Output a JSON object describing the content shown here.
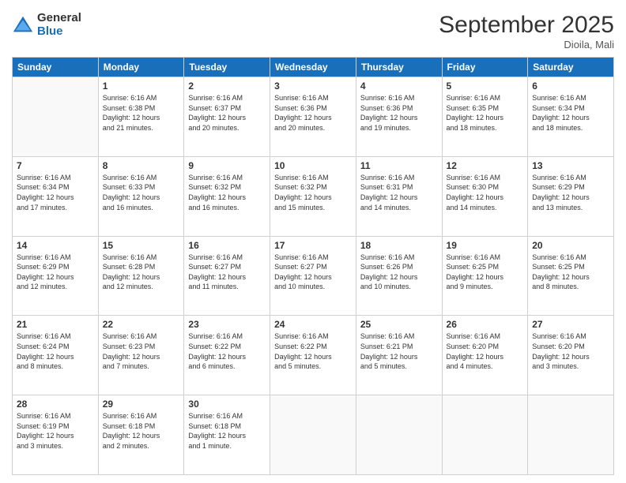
{
  "header": {
    "logo_general": "General",
    "logo_blue": "Blue",
    "month_title": "September 2025",
    "subtitle": "Dioila, Mali"
  },
  "weekdays": [
    "Sunday",
    "Monday",
    "Tuesday",
    "Wednesday",
    "Thursday",
    "Friday",
    "Saturday"
  ],
  "weeks": [
    [
      {
        "day": "",
        "info": ""
      },
      {
        "day": "1",
        "info": "Sunrise: 6:16 AM\nSunset: 6:38 PM\nDaylight: 12 hours\nand 21 minutes."
      },
      {
        "day": "2",
        "info": "Sunrise: 6:16 AM\nSunset: 6:37 PM\nDaylight: 12 hours\nand 20 minutes."
      },
      {
        "day": "3",
        "info": "Sunrise: 6:16 AM\nSunset: 6:36 PM\nDaylight: 12 hours\nand 20 minutes."
      },
      {
        "day": "4",
        "info": "Sunrise: 6:16 AM\nSunset: 6:36 PM\nDaylight: 12 hours\nand 19 minutes."
      },
      {
        "day": "5",
        "info": "Sunrise: 6:16 AM\nSunset: 6:35 PM\nDaylight: 12 hours\nand 18 minutes."
      },
      {
        "day": "6",
        "info": "Sunrise: 6:16 AM\nSunset: 6:34 PM\nDaylight: 12 hours\nand 18 minutes."
      }
    ],
    [
      {
        "day": "7",
        "info": "Sunrise: 6:16 AM\nSunset: 6:34 PM\nDaylight: 12 hours\nand 17 minutes."
      },
      {
        "day": "8",
        "info": "Sunrise: 6:16 AM\nSunset: 6:33 PM\nDaylight: 12 hours\nand 16 minutes."
      },
      {
        "day": "9",
        "info": "Sunrise: 6:16 AM\nSunset: 6:32 PM\nDaylight: 12 hours\nand 16 minutes."
      },
      {
        "day": "10",
        "info": "Sunrise: 6:16 AM\nSunset: 6:32 PM\nDaylight: 12 hours\nand 15 minutes."
      },
      {
        "day": "11",
        "info": "Sunrise: 6:16 AM\nSunset: 6:31 PM\nDaylight: 12 hours\nand 14 minutes."
      },
      {
        "day": "12",
        "info": "Sunrise: 6:16 AM\nSunset: 6:30 PM\nDaylight: 12 hours\nand 14 minutes."
      },
      {
        "day": "13",
        "info": "Sunrise: 6:16 AM\nSunset: 6:29 PM\nDaylight: 12 hours\nand 13 minutes."
      }
    ],
    [
      {
        "day": "14",
        "info": "Sunrise: 6:16 AM\nSunset: 6:29 PM\nDaylight: 12 hours\nand 12 minutes."
      },
      {
        "day": "15",
        "info": "Sunrise: 6:16 AM\nSunset: 6:28 PM\nDaylight: 12 hours\nand 12 minutes."
      },
      {
        "day": "16",
        "info": "Sunrise: 6:16 AM\nSunset: 6:27 PM\nDaylight: 12 hours\nand 11 minutes."
      },
      {
        "day": "17",
        "info": "Sunrise: 6:16 AM\nSunset: 6:27 PM\nDaylight: 12 hours\nand 10 minutes."
      },
      {
        "day": "18",
        "info": "Sunrise: 6:16 AM\nSunset: 6:26 PM\nDaylight: 12 hours\nand 10 minutes."
      },
      {
        "day": "19",
        "info": "Sunrise: 6:16 AM\nSunset: 6:25 PM\nDaylight: 12 hours\nand 9 minutes."
      },
      {
        "day": "20",
        "info": "Sunrise: 6:16 AM\nSunset: 6:25 PM\nDaylight: 12 hours\nand 8 minutes."
      }
    ],
    [
      {
        "day": "21",
        "info": "Sunrise: 6:16 AM\nSunset: 6:24 PM\nDaylight: 12 hours\nand 8 minutes."
      },
      {
        "day": "22",
        "info": "Sunrise: 6:16 AM\nSunset: 6:23 PM\nDaylight: 12 hours\nand 7 minutes."
      },
      {
        "day": "23",
        "info": "Sunrise: 6:16 AM\nSunset: 6:22 PM\nDaylight: 12 hours\nand 6 minutes."
      },
      {
        "day": "24",
        "info": "Sunrise: 6:16 AM\nSunset: 6:22 PM\nDaylight: 12 hours\nand 5 minutes."
      },
      {
        "day": "25",
        "info": "Sunrise: 6:16 AM\nSunset: 6:21 PM\nDaylight: 12 hours\nand 5 minutes."
      },
      {
        "day": "26",
        "info": "Sunrise: 6:16 AM\nSunset: 6:20 PM\nDaylight: 12 hours\nand 4 minutes."
      },
      {
        "day": "27",
        "info": "Sunrise: 6:16 AM\nSunset: 6:20 PM\nDaylight: 12 hours\nand 3 minutes."
      }
    ],
    [
      {
        "day": "28",
        "info": "Sunrise: 6:16 AM\nSunset: 6:19 PM\nDaylight: 12 hours\nand 3 minutes."
      },
      {
        "day": "29",
        "info": "Sunrise: 6:16 AM\nSunset: 6:18 PM\nDaylight: 12 hours\nand 2 minutes."
      },
      {
        "day": "30",
        "info": "Sunrise: 6:16 AM\nSunset: 6:18 PM\nDaylight: 12 hours\nand 1 minute."
      },
      {
        "day": "",
        "info": ""
      },
      {
        "day": "",
        "info": ""
      },
      {
        "day": "",
        "info": ""
      },
      {
        "day": "",
        "info": ""
      }
    ]
  ]
}
